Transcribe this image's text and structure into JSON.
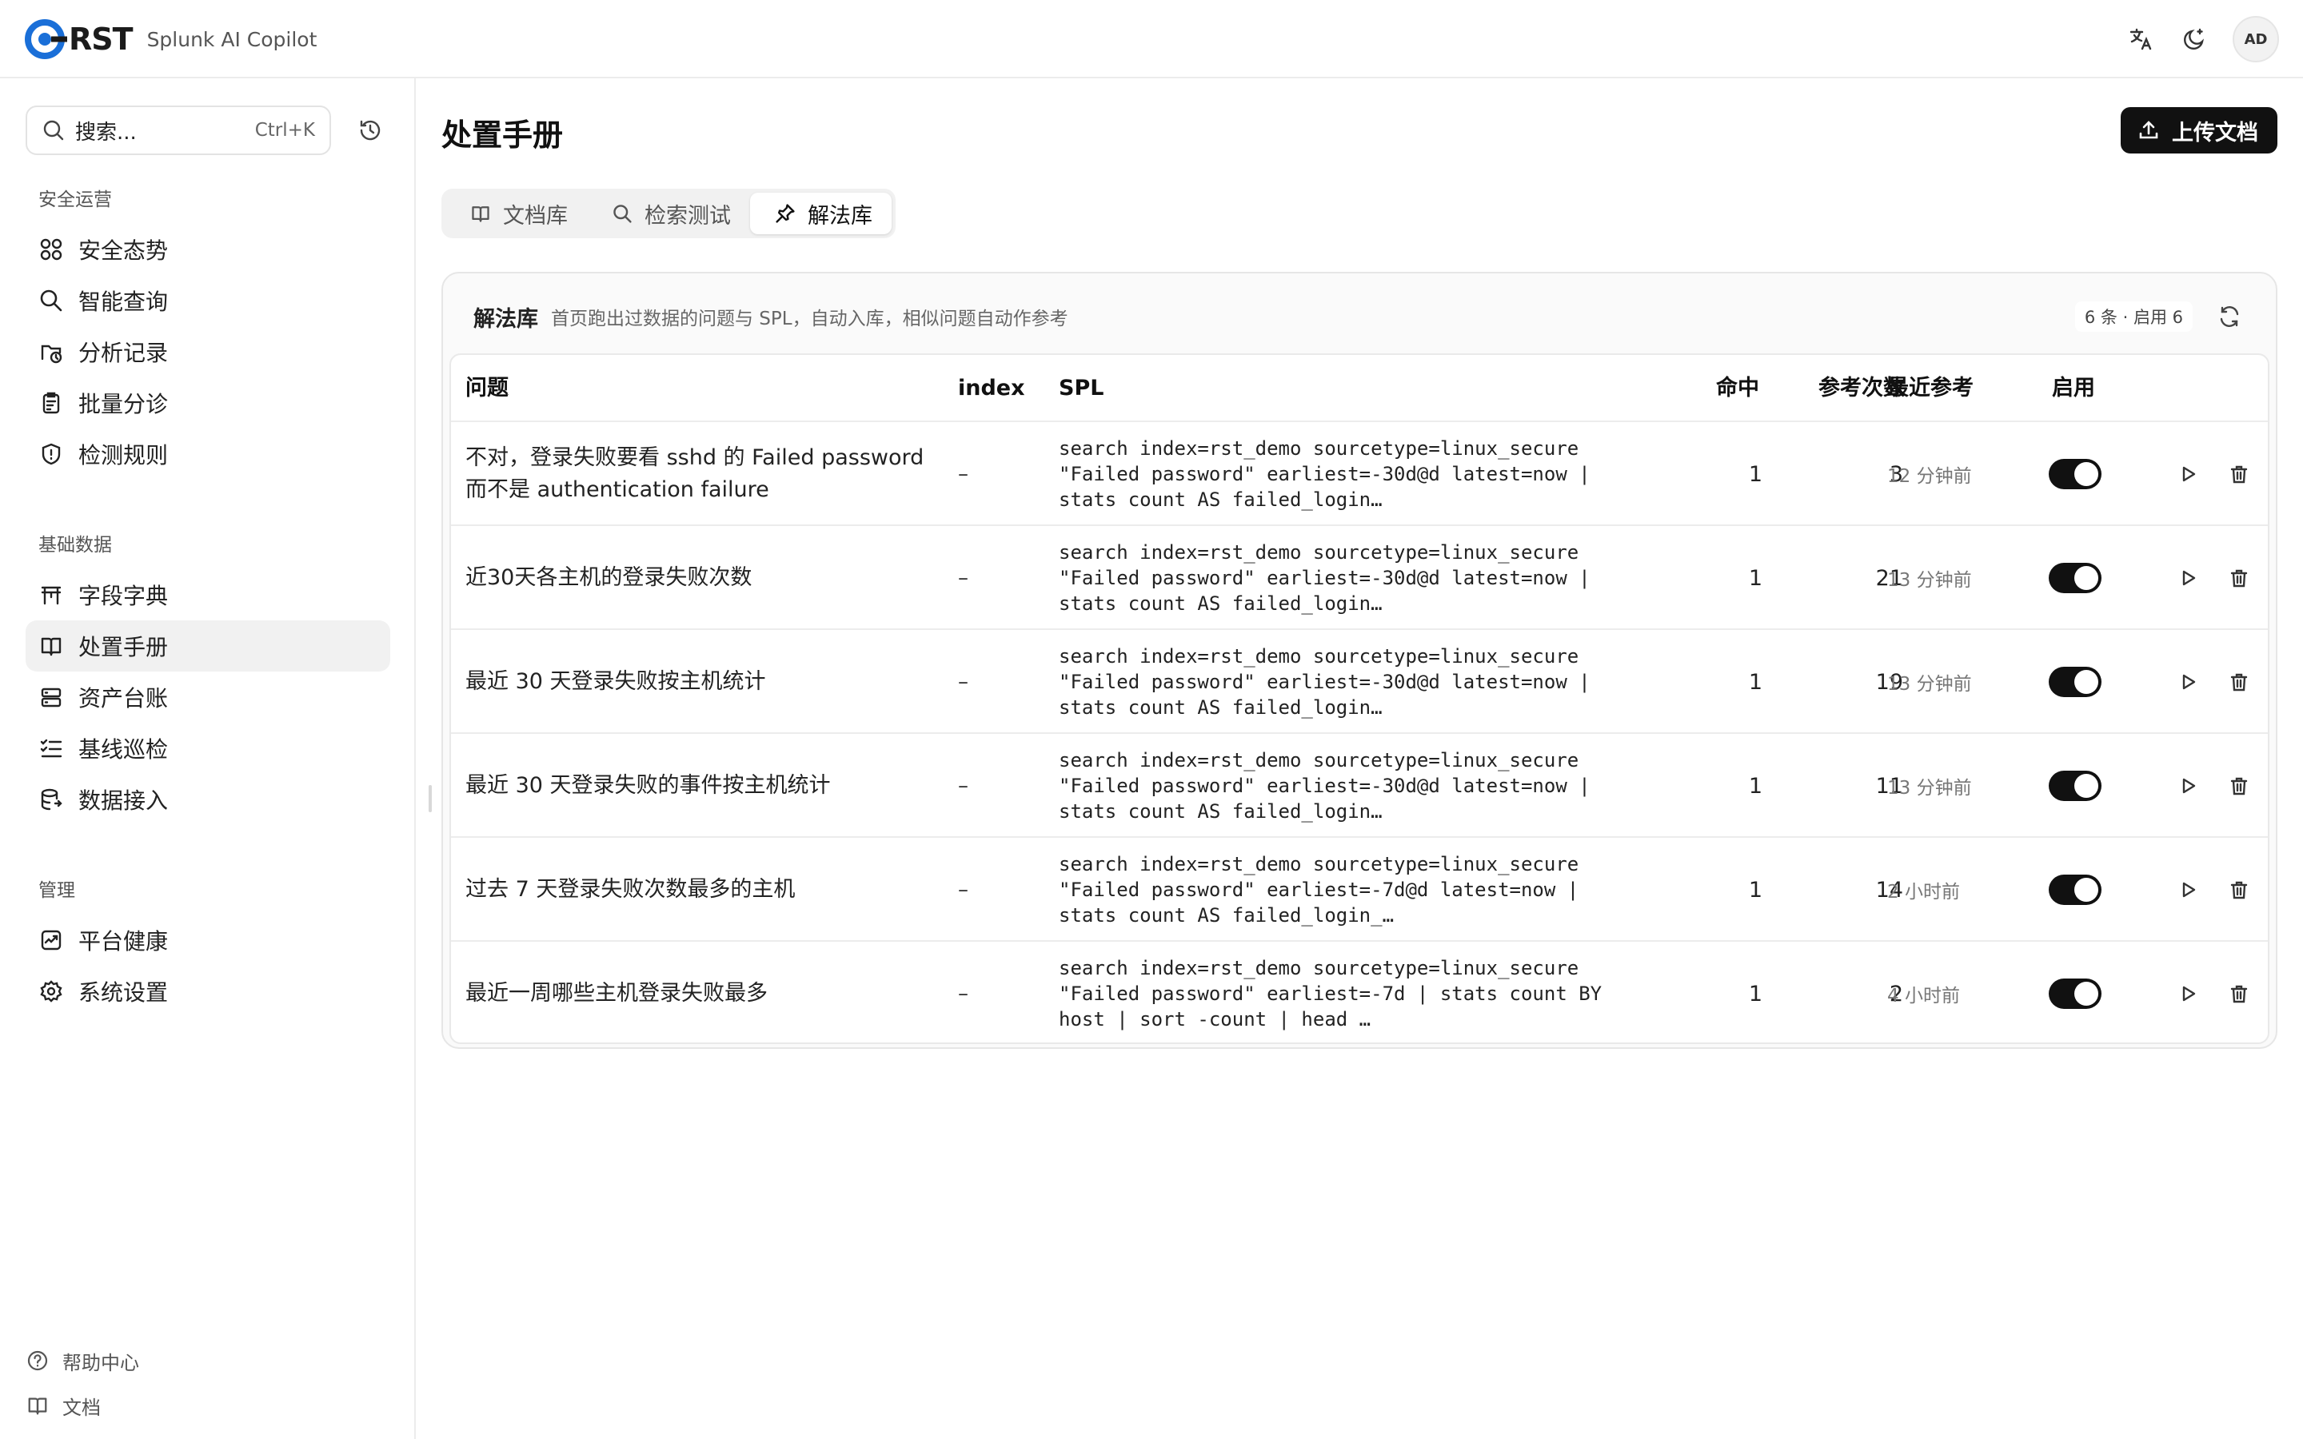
{
  "app": {
    "logo_text": "RST",
    "subtitle": "Splunk AI Copilot",
    "avatar_initials": "AD",
    "accent_color": "#1a6fd8"
  },
  "sidebar": {
    "search_placeholder": "搜索...",
    "search_shortcut": "Ctrl+K",
    "sections": [
      {
        "title": "安全运营",
        "items": [
          {
            "label": "安全态势",
            "icon": "grid-icon"
          },
          {
            "label": "智能查询",
            "icon": "search-icon"
          },
          {
            "label": "分析记录",
            "icon": "history-folder-icon"
          },
          {
            "label": "批量分诊",
            "icon": "clipboard-icon"
          },
          {
            "label": "检测规则",
            "icon": "shield-icon"
          }
        ]
      },
      {
        "title": "基础数据",
        "items": [
          {
            "label": "字段字典",
            "icon": "table-icon"
          },
          {
            "label": "处置手册",
            "icon": "book-icon",
            "active": true
          },
          {
            "label": "资产台账",
            "icon": "server-icon"
          },
          {
            "label": "基线巡检",
            "icon": "checklist-icon"
          },
          {
            "label": "数据接入",
            "icon": "database-icon"
          }
        ]
      },
      {
        "title": "管理",
        "items": [
          {
            "label": "平台健康",
            "icon": "health-icon"
          },
          {
            "label": "系统设置",
            "icon": "gear-icon"
          }
        ]
      }
    ],
    "footer": [
      {
        "label": "帮助中心",
        "icon": "help-icon"
      },
      {
        "label": "文档",
        "icon": "book-icon"
      }
    ]
  },
  "main": {
    "page_title": "处置手册",
    "upload_label": "上传文档",
    "tabs": [
      {
        "label": "文档库",
        "icon": "book-icon"
      },
      {
        "label": "检索测试",
        "icon": "search-icon"
      },
      {
        "label": "解法库",
        "icon": "pin-icon",
        "active": true
      }
    ],
    "card": {
      "title": "解法库",
      "description": "首页跑出过数据的问题与 SPL，自动入库，相似问题自动作参考",
      "count_badge": "6 条 · 启用 6"
    },
    "table": {
      "columns": [
        "问题",
        "index",
        "SPL",
        "命中",
        "参考次数",
        "最近参考",
        "启用"
      ],
      "rows": [
        {
          "question": "不对，登录失败要看 sshd 的 Failed password 而不是 authentication failure",
          "index": "–",
          "spl": "search index=rst_demo sourcetype=linux_secure \"Failed password\" earliest=-30d@d latest=now | stats count AS failed_login…",
          "hit": "1",
          "refs": "3",
          "last": "12 分钟前",
          "enabled": true
        },
        {
          "question": "近30天各主机的登录失败次数",
          "index": "–",
          "spl": "search index=rst_demo sourcetype=linux_secure \"Failed password\" earliest=-30d@d latest=now | stats count AS failed_login…",
          "hit": "1",
          "refs": "21",
          "last": "13 分钟前",
          "enabled": true
        },
        {
          "question": "最近 30 天登录失败按主机统计",
          "index": "–",
          "spl": "search index=rst_demo sourcetype=linux_secure \"Failed password\" earliest=-30d@d latest=now | stats count AS failed_login…",
          "hit": "1",
          "refs": "19",
          "last": "13 分钟前",
          "enabled": true
        },
        {
          "question": "最近 30 天登录失败的事件按主机统计",
          "index": "–",
          "spl": "search index=rst_demo sourcetype=linux_secure \"Failed password\" earliest=-30d@d latest=now | stats count AS failed_login…",
          "hit": "1",
          "refs": "11",
          "last": "13 分钟前",
          "enabled": true
        },
        {
          "question": "过去 7 天登录失败次数最多的主机",
          "index": "–",
          "spl": "search index=rst_demo sourcetype=linux_secure \"Failed password\" earliest=-7d@d latest=now | stats count AS failed_login_…",
          "hit": "1",
          "refs": "14",
          "last": "2 小时前",
          "enabled": true
        },
        {
          "question": "最近一周哪些主机登录失败最多",
          "index": "–",
          "spl": "search index=rst_demo sourcetype=linux_secure \"Failed password\" earliest=-7d | stats count BY host | sort -count | head …",
          "hit": "1",
          "refs": "2",
          "last": "4 小时前",
          "enabled": true
        }
      ]
    }
  }
}
